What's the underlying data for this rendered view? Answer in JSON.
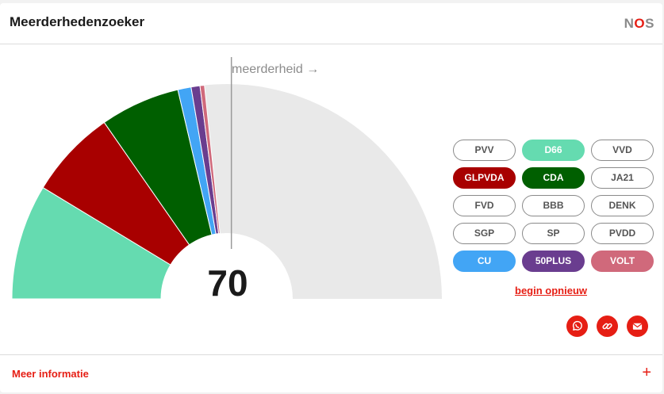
{
  "header": {
    "title": "Meerderhedenzoeker",
    "logo": {
      "n": "N",
      "o": "O",
      "s": "S"
    }
  },
  "chart": {
    "majority_label": "meerderheid →",
    "seat_count": "70",
    "total_seats": 150,
    "majority_seats": 76,
    "empty_color": "#e9e9e9",
    "segments": [
      {
        "party": "D66",
        "seats": 26,
        "color": "#65dbb0"
      },
      {
        "party": "GLPVDA",
        "seats": 20,
        "color": "#a80000"
      },
      {
        "party": "CDA",
        "seats": 18,
        "color": "#005f00"
      },
      {
        "party": "CU",
        "seats": 3,
        "color": "#42a5f5"
      },
      {
        "party": "50PLUS",
        "seats": 2,
        "color": "#6a3d8f"
      },
      {
        "party": "VOLT",
        "seats": 1,
        "color": "#d0697b"
      }
    ]
  },
  "parties": [
    {
      "label": "PVV",
      "selected": false,
      "color": ""
    },
    {
      "label": "D66",
      "selected": true,
      "color": "#65dbb0"
    },
    {
      "label": "VVD",
      "selected": false,
      "color": ""
    },
    {
      "label": "GLPVDA",
      "selected": true,
      "color": "#a80000"
    },
    {
      "label": "CDA",
      "selected": true,
      "color": "#005f00"
    },
    {
      "label": "JA21",
      "selected": false,
      "color": ""
    },
    {
      "label": "FVD",
      "selected": false,
      "color": ""
    },
    {
      "label": "BBB",
      "selected": false,
      "color": ""
    },
    {
      "label": "DENK",
      "selected": false,
      "color": ""
    },
    {
      "label": "SGP",
      "selected": false,
      "color": ""
    },
    {
      "label": "SP",
      "selected": false,
      "color": ""
    },
    {
      "label": "PVDD",
      "selected": false,
      "color": ""
    },
    {
      "label": "CU",
      "selected": true,
      "color": "#42a5f5"
    },
    {
      "label": "50PLUS",
      "selected": true,
      "color": "#6a3d8f"
    },
    {
      "label": "VOLT",
      "selected": true,
      "color": "#d0697b"
    }
  ],
  "actions": {
    "reset_label": "begin opnieuw",
    "share_icons": [
      "whatsapp-icon",
      "link-icon",
      "mail-icon"
    ]
  },
  "footer": {
    "more_info_label": "Meer informatie",
    "expand_symbol": "+"
  },
  "colors": {
    "accent": "#e61e14"
  }
}
